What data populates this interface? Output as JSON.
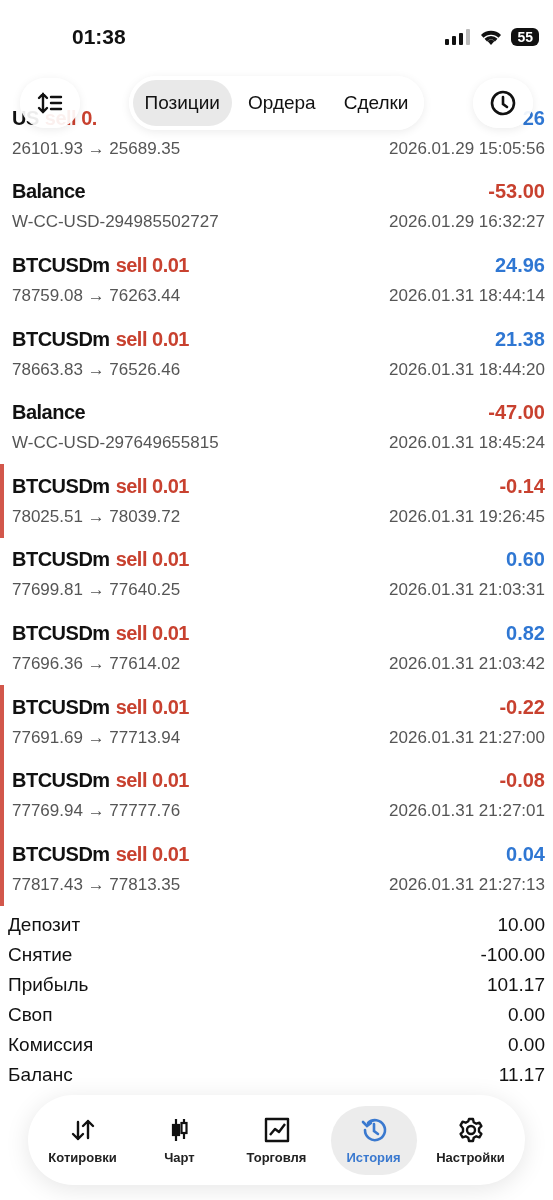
{
  "status_bar": {
    "time": "01:38",
    "battery": "55"
  },
  "toolbar": {
    "tabs": [
      {
        "label": "Позиции",
        "selected": true
      },
      {
        "label": "Ордера",
        "selected": false
      },
      {
        "label": "Сделки",
        "selected": false
      }
    ]
  },
  "deals": [
    {
      "kind": "trade",
      "symbol": "US",
      "action": "sell 0.",
      "profit": "26",
      "positive": true,
      "flagged": false,
      "prices": "26101.93 → 25689.35",
      "time": "2026.01.29 15:05:56"
    },
    {
      "kind": "balance",
      "symbol": "Balance",
      "profit": "-53.00",
      "positive": false,
      "flagged": false,
      "prices": "W-CC-USD-294985502727",
      "time": "2026.01.29 16:32:27"
    },
    {
      "kind": "trade",
      "symbol": "BTCUSDm",
      "action": "sell 0.01",
      "profit": "24.96",
      "positive": true,
      "flagged": false,
      "prices": "78759.08 → 76263.44",
      "time": "2026.01.31 18:44:14"
    },
    {
      "kind": "trade",
      "symbol": "BTCUSDm",
      "action": "sell 0.01",
      "profit": "21.38",
      "positive": true,
      "flagged": false,
      "prices": "78663.83 → 76526.46",
      "time": "2026.01.31 18:44:20"
    },
    {
      "kind": "balance",
      "symbol": "Balance",
      "profit": "-47.00",
      "positive": false,
      "flagged": false,
      "prices": "W-CC-USD-297649655815",
      "time": "2026.01.31 18:45:24"
    },
    {
      "kind": "trade",
      "symbol": "BTCUSDm",
      "action": "sell 0.01",
      "profit": "-0.14",
      "positive": false,
      "flagged": true,
      "prices": "78025.51 → 78039.72",
      "time": "2026.01.31 19:26:45"
    },
    {
      "kind": "trade",
      "symbol": "BTCUSDm",
      "action": "sell 0.01",
      "profit": "0.60",
      "positive": true,
      "flagged": false,
      "prices": "77699.81 → 77640.25",
      "time": "2026.01.31 21:03:31"
    },
    {
      "kind": "trade",
      "symbol": "BTCUSDm",
      "action": "sell 0.01",
      "profit": "0.82",
      "positive": true,
      "flagged": false,
      "prices": "77696.36 → 77614.02",
      "time": "2026.01.31 21:03:42"
    },
    {
      "kind": "trade",
      "symbol": "BTCUSDm",
      "action": "sell 0.01",
      "profit": "-0.22",
      "positive": false,
      "flagged": true,
      "prices": "77691.69 → 77713.94",
      "time": "2026.01.31 21:27:00"
    },
    {
      "kind": "trade",
      "symbol": "BTCUSDm",
      "action": "sell 0.01",
      "profit": "-0.08",
      "positive": false,
      "flagged": true,
      "prices": "77769.94 → 77777.76",
      "time": "2026.01.31 21:27:01"
    },
    {
      "kind": "trade",
      "symbol": "BTCUSDm",
      "action": "sell 0.01",
      "profit": "0.04",
      "positive": true,
      "flagged": true,
      "prices": "77817.43 → 77813.35",
      "time": "2026.01.31 21:27:13"
    }
  ],
  "summary": [
    {
      "label": "Депозит",
      "value": "10.00"
    },
    {
      "label": "Снятие",
      "value": "-100.00"
    },
    {
      "label": "Прибыль",
      "value": "101.17"
    },
    {
      "label": "Своп",
      "value": "0.00"
    },
    {
      "label": "Комиссия",
      "value": "0.00"
    },
    {
      "label": "Баланс",
      "value": "11.17"
    }
  ],
  "tab_bar": [
    {
      "kind": "quotes",
      "label": "Котировки",
      "selected": false
    },
    {
      "kind": "chart",
      "label": "Чарт",
      "selected": false
    },
    {
      "kind": "trade",
      "label": "Торговля",
      "selected": false
    },
    {
      "kind": "history",
      "label": "История",
      "selected": true
    },
    {
      "kind": "settings",
      "label": "Настройки",
      "selected": false
    }
  ]
}
